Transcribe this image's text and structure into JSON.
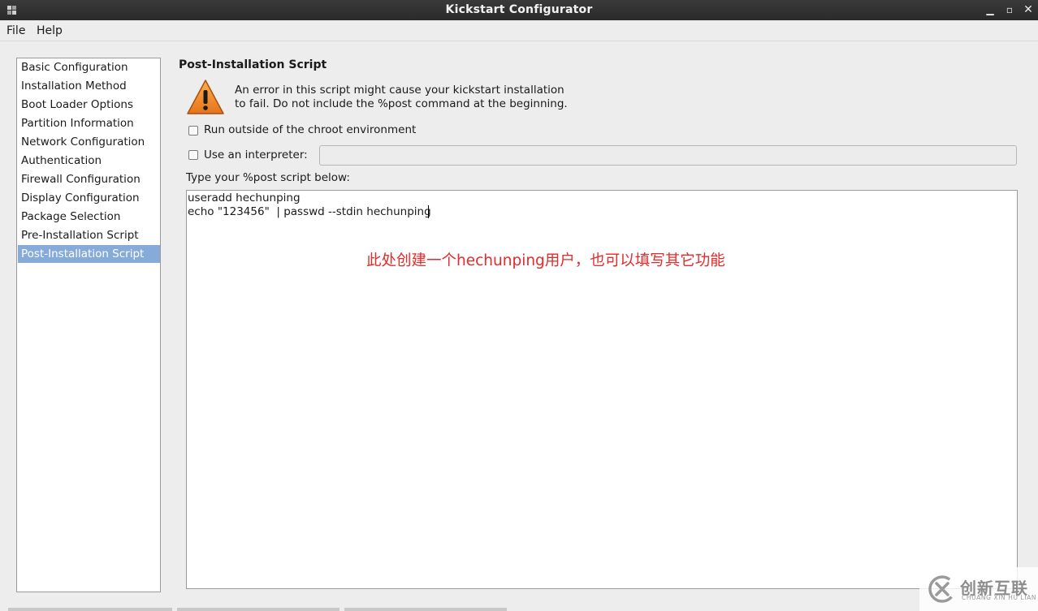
{
  "window": {
    "title": "Kickstart Configurator",
    "icon": "app-icon",
    "controls": {
      "minimize": "▁",
      "maximize": "▫",
      "close": "✕"
    }
  },
  "menubar": {
    "items": [
      "File",
      "Help"
    ]
  },
  "sidebar": {
    "items": [
      {
        "label": "Basic Configuration"
      },
      {
        "label": "Installation Method"
      },
      {
        "label": "Boot Loader Options"
      },
      {
        "label": "Partition Information"
      },
      {
        "label": "Network Configuration"
      },
      {
        "label": "Authentication"
      },
      {
        "label": "Firewall Configuration"
      },
      {
        "label": "Display Configuration"
      },
      {
        "label": "Package Selection"
      },
      {
        "label": "Pre-Installation Script"
      },
      {
        "label": "Post-Installation Script"
      }
    ],
    "selected": "Post-Installation Script"
  },
  "main": {
    "title": "Post-Installation Script",
    "warning": {
      "line1": "An error in this script might cause your kickstart installation",
      "line2": "to fail. Do not include the %post command at the beginning."
    },
    "options": {
      "chroot_label": "Run outside of the chroot environment",
      "chroot_checked": false,
      "interpreter_label": "Use an interpreter:",
      "interpreter_checked": false,
      "interpreter_value": ""
    },
    "script_label": "Type your %post script below:",
    "script_lines": [
      "useradd hechunping",
      "echo \"123456\"  | passwd --stdin hechunping"
    ],
    "annotation": "此处创建一个hechunping用户，也可以填写其它功能"
  },
  "watermark": {
    "name": "创新互联",
    "sub": "CHUANG XIN HU LIAN"
  },
  "colors": {
    "selection": "#86abd9",
    "annotation": "#e52a2a",
    "titlebar": "#2f2f2f",
    "warning_orange": "#f08a24"
  }
}
